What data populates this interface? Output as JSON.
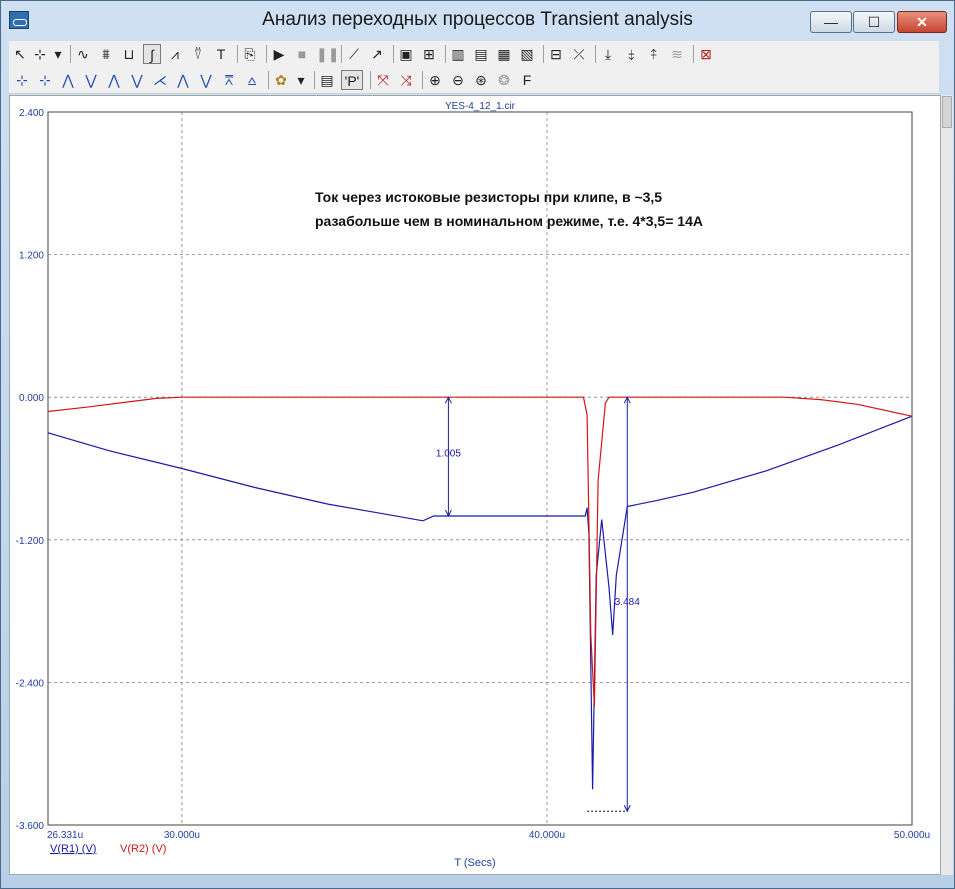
{
  "window": {
    "title": "Анализ переходных процессов Transient analysis",
    "min_glyph": "—",
    "max_glyph": "☐",
    "close_glyph": "✕"
  },
  "toolbar1": [
    {
      "name": "select-tool",
      "glyph": "↖",
      "w": 14
    },
    {
      "name": "scale-tool",
      "glyph": "⊹",
      "w": 16
    },
    {
      "name": "dropdown-arrow",
      "glyph": "▾",
      "w": 10
    },
    {
      "sep": true
    },
    {
      "name": "waveform-tool-1",
      "glyph": "∿",
      "w": 18
    },
    {
      "name": "waveform-tool-2",
      "glyph": "⩩",
      "w": 18
    },
    {
      "name": "waveform-tool-3",
      "glyph": "⊔",
      "w": 18
    },
    {
      "name": "waveform-tool-4",
      "glyph": "∫",
      "w": 18,
      "active": true
    },
    {
      "name": "waveform-tool-5",
      "glyph": "⩘",
      "w": 18
    },
    {
      "name": "waveform-tool-6",
      "glyph": "⍢",
      "w": 18
    },
    {
      "name": "text-tool",
      "glyph": "T",
      "w": 18
    },
    {
      "sep": true
    },
    {
      "name": "properties-tool",
      "glyph": "⎘",
      "w": 18
    },
    {
      "sep": true
    },
    {
      "name": "run-button",
      "glyph": "▶",
      "w": 18
    },
    {
      "name": "stop-button",
      "glyph": "■",
      "w": 18,
      "color": "#9a9a9a"
    },
    {
      "name": "pause-button",
      "glyph": "❚❚",
      "w": 18,
      "color": "#9a9a9a"
    },
    {
      "sep": true
    },
    {
      "name": "line-tool",
      "glyph": "⟋",
      "w": 18
    },
    {
      "name": "arrow-tool",
      "glyph": "↗",
      "w": 18
    },
    {
      "sep": true
    },
    {
      "name": "frame-tool",
      "glyph": "▣",
      "w": 18
    },
    {
      "name": "grid-tool",
      "glyph": "⊞",
      "w": 18
    },
    {
      "sep": true
    },
    {
      "name": "grid-tool-2",
      "glyph": "▥",
      "w": 18
    },
    {
      "name": "grid-tool-3",
      "glyph": "▤",
      "w": 18
    },
    {
      "name": "grid-tool-4",
      "glyph": "▦",
      "w": 18
    },
    {
      "name": "grid-tool-5",
      "glyph": "▧",
      "w": 18
    },
    {
      "sep": true
    },
    {
      "name": "plot-tool-1",
      "glyph": "⊟",
      "w": 18
    },
    {
      "name": "plot-tool-2",
      "glyph": "⤫",
      "w": 18
    },
    {
      "sep": true
    },
    {
      "name": "cursor-tool-1",
      "glyph": "⤓",
      "w": 18
    },
    {
      "name": "cursor-tool-2",
      "glyph": "⤈",
      "w": 18
    },
    {
      "name": "cursor-tool-3",
      "glyph": "⤉",
      "w": 18
    },
    {
      "name": "cursor-tool-4",
      "glyph": "≋",
      "w": 18,
      "color": "#9a9a9a"
    },
    {
      "sep": true
    },
    {
      "name": "close-plot-tool",
      "glyph": "⊠",
      "w": 18,
      "color": "#b02020"
    }
  ],
  "toolbar2": [
    {
      "name": "cursor-left-tool",
      "glyph": "⊹",
      "w": 18,
      "color": "#2050b0"
    },
    {
      "name": "cursor-right-tool",
      "glyph": "⊹",
      "w": 18,
      "color": "#2050b0"
    },
    {
      "name": "peak-tool",
      "glyph": "⋀",
      "w": 18,
      "color": "#2050b0"
    },
    {
      "name": "valley-tool",
      "glyph": "⋁",
      "w": 18,
      "color": "#2050b0"
    },
    {
      "name": "high-tool",
      "glyph": "⋀",
      "w": 18,
      "color": "#2050b0"
    },
    {
      "name": "low-tool",
      "glyph": "⋁",
      "w": 18,
      "color": "#2050b0"
    },
    {
      "name": "inflection-tool",
      "glyph": "⋌",
      "w": 18,
      "color": "#2050b0"
    },
    {
      "name": "global-high-tool",
      "glyph": "⋀",
      "w": 18,
      "color": "#2050b0"
    },
    {
      "name": "global-low-tool",
      "glyph": "⋁",
      "w": 18,
      "color": "#2050b0"
    },
    {
      "name": "top-tool",
      "glyph": "⩞",
      "w": 18,
      "color": "#2050b0"
    },
    {
      "name": "bottom-tool",
      "glyph": "⩟",
      "w": 18,
      "color": "#2050b0"
    },
    {
      "sep": true
    },
    {
      "name": "color-tool",
      "glyph": "✿",
      "w": 18,
      "color": "#b08020"
    },
    {
      "name": "dropdown-arrow-2",
      "glyph": "▾",
      "w": 12
    },
    {
      "sep": true
    },
    {
      "name": "table-tool",
      "glyph": "▤",
      "w": 18
    },
    {
      "name": "point-tag-tool",
      "glyph": "'P'",
      "w": 22,
      "active": true
    },
    {
      "sep": true
    },
    {
      "name": "tag-tool-1",
      "glyph": "⤧",
      "w": 18,
      "color": "#b02020"
    },
    {
      "name": "tag-tool-2",
      "glyph": "⤨",
      "w": 18,
      "color": "#b02020"
    },
    {
      "sep": true
    },
    {
      "name": "zoom-in-tool",
      "glyph": "⊕",
      "w": 18
    },
    {
      "name": "zoom-out-tool",
      "glyph": "⊖",
      "w": 18
    },
    {
      "name": "zoom-fit-tool",
      "glyph": "⊛",
      "w": 18
    },
    {
      "name": "pan-tool",
      "glyph": "❂",
      "w": 18,
      "color": "#9a9a9a"
    },
    {
      "name": "font-tool",
      "glyph": "F",
      "w": 18
    }
  ],
  "plot": {
    "file_name": "YES-4_12_1.cir",
    "annotation_line1": "Ток через истоковые резисторы при клипе, в ~3,5",
    "annotation_line2": "разабольше чем в номинальном режиме, т.е. 4*3,5= 14A",
    "x_axis_label": "T (Secs)",
    "y_ticks": [
      "2.400",
      "1.200",
      "0.000",
      "-1.200",
      "-2.400",
      "-3.600"
    ],
    "x_ticks": [
      "26.331u",
      "30.000u",
      "40.000u",
      "50.000u"
    ],
    "measurement_1": "1.005",
    "measurement_2": "3.484",
    "colors": {
      "r1": "#1a1aa8",
      "r2": "#d01818",
      "axis_text": "#2040a0",
      "grid": "#808080"
    }
  },
  "chart_data": {
    "type": "line",
    "title": "YES-4_12_1.cir",
    "xlabel": "T (Secs)",
    "ylabel": "",
    "xlim": [
      26.331,
      50.0
    ],
    "ylim": [
      -3.6,
      2.4
    ],
    "x_unit": "u",
    "grid": true,
    "series": [
      {
        "name": "V(R1) (V)",
        "color": "#1a1aa8",
        "points": [
          [
            26.331,
            -0.3
          ],
          [
            28,
            -0.45
          ],
          [
            30,
            -0.6
          ],
          [
            32,
            -0.76
          ],
          [
            34,
            -0.9
          ],
          [
            35.5,
            -0.98
          ],
          [
            36.6,
            -1.04
          ],
          [
            36.9,
            -1.0
          ],
          [
            37.3,
            -1.0
          ],
          [
            39,
            -1.0
          ],
          [
            41.05,
            -1.0
          ],
          [
            41.1,
            -0.93
          ],
          [
            41.15,
            -1.15
          ],
          [
            41.25,
            -3.3
          ],
          [
            41.35,
            -1.5
          ],
          [
            41.5,
            -1.03
          ],
          [
            41.7,
            -1.6
          ],
          [
            41.8,
            -2.0
          ],
          [
            41.9,
            -1.5
          ],
          [
            42.2,
            -0.92
          ],
          [
            43,
            -0.87
          ],
          [
            44,
            -0.8
          ],
          [
            46,
            -0.62
          ],
          [
            48,
            -0.4
          ],
          [
            50,
            -0.16
          ]
        ]
      },
      {
        "name": "V(R2) (V)",
        "color": "#d01818",
        "points": [
          [
            26.331,
            -0.12
          ],
          [
            27.5,
            -0.08
          ],
          [
            28.5,
            -0.04
          ],
          [
            29.3,
            -0.01
          ],
          [
            30,
            0.0
          ],
          [
            41.0,
            0.0
          ],
          [
            41.1,
            -0.15
          ],
          [
            41.2,
            -2.0
          ],
          [
            41.3,
            -2.6
          ],
          [
            41.4,
            -0.7
          ],
          [
            41.6,
            -0.05
          ],
          [
            41.7,
            0.0
          ],
          [
            46.5,
            0.0
          ],
          [
            47.5,
            -0.02
          ],
          [
            48.5,
            -0.06
          ],
          [
            50,
            -0.16
          ]
        ]
      }
    ],
    "annotations": [
      "1.005",
      "3.484"
    ]
  }
}
